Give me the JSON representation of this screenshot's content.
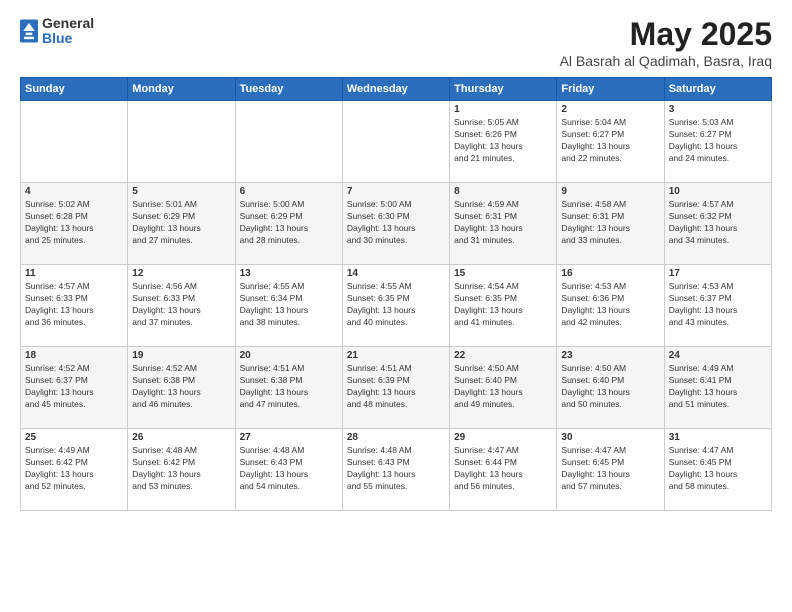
{
  "logo": {
    "general": "General",
    "blue": "Blue"
  },
  "title": {
    "month": "May 2025",
    "location": "Al Basrah al Qadimah, Basra, Iraq"
  },
  "headers": [
    "Sunday",
    "Monday",
    "Tuesday",
    "Wednesday",
    "Thursday",
    "Friday",
    "Saturday"
  ],
  "weeks": [
    [
      {
        "day": "",
        "info": ""
      },
      {
        "day": "",
        "info": ""
      },
      {
        "day": "",
        "info": ""
      },
      {
        "day": "",
        "info": ""
      },
      {
        "day": "1",
        "info": "Sunrise: 5:05 AM\nSunset: 6:26 PM\nDaylight: 13 hours\nand 21 minutes."
      },
      {
        "day": "2",
        "info": "Sunrise: 5:04 AM\nSunset: 6:27 PM\nDaylight: 13 hours\nand 22 minutes."
      },
      {
        "day": "3",
        "info": "Sunrise: 5:03 AM\nSunset: 6:27 PM\nDaylight: 13 hours\nand 24 minutes."
      }
    ],
    [
      {
        "day": "4",
        "info": "Sunrise: 5:02 AM\nSunset: 6:28 PM\nDaylight: 13 hours\nand 25 minutes."
      },
      {
        "day": "5",
        "info": "Sunrise: 5:01 AM\nSunset: 6:29 PM\nDaylight: 13 hours\nand 27 minutes."
      },
      {
        "day": "6",
        "info": "Sunrise: 5:00 AM\nSunset: 6:29 PM\nDaylight: 13 hours\nand 28 minutes."
      },
      {
        "day": "7",
        "info": "Sunrise: 5:00 AM\nSunset: 6:30 PM\nDaylight: 13 hours\nand 30 minutes."
      },
      {
        "day": "8",
        "info": "Sunrise: 4:59 AM\nSunset: 6:31 PM\nDaylight: 13 hours\nand 31 minutes."
      },
      {
        "day": "9",
        "info": "Sunrise: 4:58 AM\nSunset: 6:31 PM\nDaylight: 13 hours\nand 33 minutes."
      },
      {
        "day": "10",
        "info": "Sunrise: 4:57 AM\nSunset: 6:32 PM\nDaylight: 13 hours\nand 34 minutes."
      }
    ],
    [
      {
        "day": "11",
        "info": "Sunrise: 4:57 AM\nSunset: 6:33 PM\nDaylight: 13 hours\nand 36 minutes."
      },
      {
        "day": "12",
        "info": "Sunrise: 4:56 AM\nSunset: 6:33 PM\nDaylight: 13 hours\nand 37 minutes."
      },
      {
        "day": "13",
        "info": "Sunrise: 4:55 AM\nSunset: 6:34 PM\nDaylight: 13 hours\nand 38 minutes."
      },
      {
        "day": "14",
        "info": "Sunrise: 4:55 AM\nSunset: 6:35 PM\nDaylight: 13 hours\nand 40 minutes."
      },
      {
        "day": "15",
        "info": "Sunrise: 4:54 AM\nSunset: 6:35 PM\nDaylight: 13 hours\nand 41 minutes."
      },
      {
        "day": "16",
        "info": "Sunrise: 4:53 AM\nSunset: 6:36 PM\nDaylight: 13 hours\nand 42 minutes."
      },
      {
        "day": "17",
        "info": "Sunrise: 4:53 AM\nSunset: 6:37 PM\nDaylight: 13 hours\nand 43 minutes."
      }
    ],
    [
      {
        "day": "18",
        "info": "Sunrise: 4:52 AM\nSunset: 6:37 PM\nDaylight: 13 hours\nand 45 minutes."
      },
      {
        "day": "19",
        "info": "Sunrise: 4:52 AM\nSunset: 6:38 PM\nDaylight: 13 hours\nand 46 minutes."
      },
      {
        "day": "20",
        "info": "Sunrise: 4:51 AM\nSunset: 6:38 PM\nDaylight: 13 hours\nand 47 minutes."
      },
      {
        "day": "21",
        "info": "Sunrise: 4:51 AM\nSunset: 6:39 PM\nDaylight: 13 hours\nand 48 minutes."
      },
      {
        "day": "22",
        "info": "Sunrise: 4:50 AM\nSunset: 6:40 PM\nDaylight: 13 hours\nand 49 minutes."
      },
      {
        "day": "23",
        "info": "Sunrise: 4:50 AM\nSunset: 6:40 PM\nDaylight: 13 hours\nand 50 minutes."
      },
      {
        "day": "24",
        "info": "Sunrise: 4:49 AM\nSunset: 6:41 PM\nDaylight: 13 hours\nand 51 minutes."
      }
    ],
    [
      {
        "day": "25",
        "info": "Sunrise: 4:49 AM\nSunset: 6:42 PM\nDaylight: 13 hours\nand 52 minutes."
      },
      {
        "day": "26",
        "info": "Sunrise: 4:48 AM\nSunset: 6:42 PM\nDaylight: 13 hours\nand 53 minutes."
      },
      {
        "day": "27",
        "info": "Sunrise: 4:48 AM\nSunset: 6:43 PM\nDaylight: 13 hours\nand 54 minutes."
      },
      {
        "day": "28",
        "info": "Sunrise: 4:48 AM\nSunset: 6:43 PM\nDaylight: 13 hours\nand 55 minutes."
      },
      {
        "day": "29",
        "info": "Sunrise: 4:47 AM\nSunset: 6:44 PM\nDaylight: 13 hours\nand 56 minutes."
      },
      {
        "day": "30",
        "info": "Sunrise: 4:47 AM\nSunset: 6:45 PM\nDaylight: 13 hours\nand 57 minutes."
      },
      {
        "day": "31",
        "info": "Sunrise: 4:47 AM\nSunset: 6:45 PM\nDaylight: 13 hours\nand 58 minutes."
      }
    ]
  ]
}
